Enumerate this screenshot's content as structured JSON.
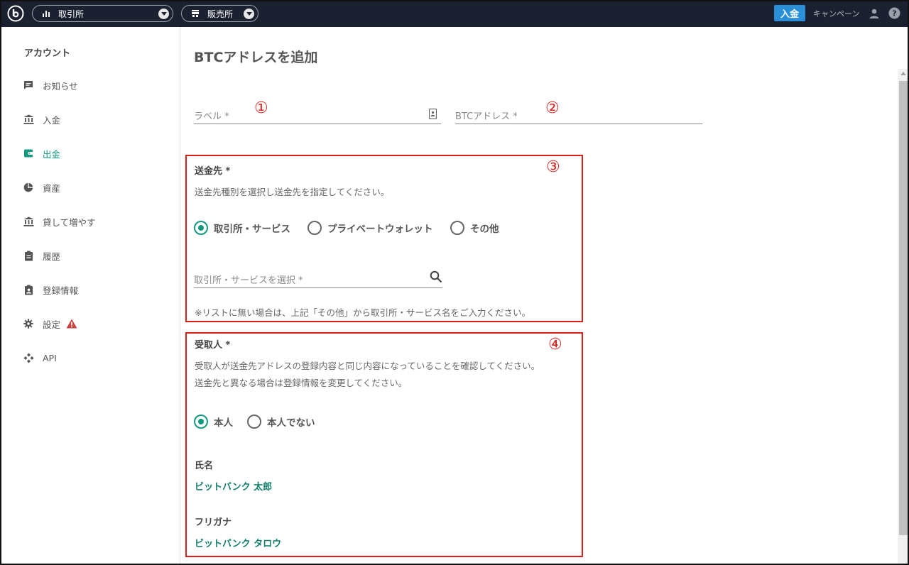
{
  "topbar": {
    "exchange_label": "取引所",
    "sales_label": "販売所",
    "deposit_label": "入金",
    "campaign_label": "キャンペーン",
    "accent": "#2a8fd6",
    "background": "#1b2130"
  },
  "sidebar": {
    "heading": "アカウント",
    "items": [
      {
        "label": "お知らせ",
        "icon": "message-icon"
      },
      {
        "label": "入金",
        "icon": "bank-icon"
      },
      {
        "label": "出金",
        "icon": "wallet-icon",
        "active": true
      },
      {
        "label": "資産",
        "icon": "pie-chart-icon"
      },
      {
        "label": "貸して増やす",
        "icon": "bank-icon"
      },
      {
        "label": "履歴",
        "icon": "clipboard-icon"
      },
      {
        "label": "登録情報",
        "icon": "id-card-icon"
      },
      {
        "label": "設定",
        "icon": "gear-icon",
        "warning": true
      },
      {
        "label": "API",
        "icon": "api-icon"
      }
    ],
    "active_color": "#12997f"
  },
  "main": {
    "title": "BTCアドレスを追加",
    "label_field": {
      "placeholder": "ラベル *"
    },
    "address_field": {
      "placeholder": "BTCアドレス *"
    },
    "markers": [
      "①",
      "②",
      "③",
      "④"
    ],
    "destination": {
      "title": "送金先 *",
      "description": "送金先種別を選択し送金先を指定してください。",
      "options": [
        "取引所・サービス",
        "プライベートウォレット",
        "その他"
      ],
      "selected_index": 0,
      "search_placeholder": "取引所・サービスを選択 *",
      "note": "※リストに無い場合は、上記「その他」から取引所・サービス名をご入力ください。"
    },
    "recipient": {
      "title": "受取人 *",
      "description_1": "受取人が送金先アドレスの登録内容と同じ内容になっていることを確認してください。",
      "description_2": "送金先と異なる場合は登録情報を変更してください。",
      "options": [
        "本人",
        "本人でない"
      ],
      "selected_index": 0,
      "name_label": "氏名",
      "name_value": "ビットバンク 太郎",
      "kana_label": "フリガナ",
      "kana_value": "ビットバンク タロウ"
    },
    "highlight_color": "#d9201c",
    "accent": "#12997f"
  }
}
